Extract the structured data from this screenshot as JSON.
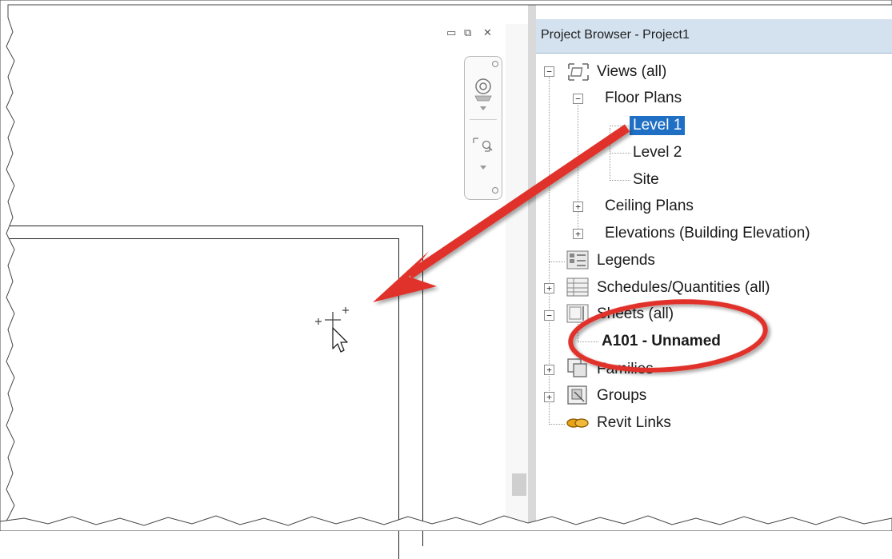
{
  "browser": {
    "title": "Project Browser - Project1"
  },
  "window_controls": {
    "minimize": "▭",
    "restore": "⧉",
    "close": "✕",
    "collapse": "^"
  },
  "tree": {
    "views": "Views (all)",
    "floor_plans": "Floor Plans",
    "level1": "Level 1",
    "level2": "Level 2",
    "site": "Site",
    "ceiling_plans": "Ceiling Plans",
    "elevations": "Elevations (Building Elevation)",
    "legends": "Legends",
    "schedules": "Schedules/Quantities (all)",
    "sheets": "Sheets (all)",
    "sheet_a101": "A101 - Unnamed",
    "families": "Families",
    "groups": "Groups",
    "revit_links": "Revit Links"
  },
  "colors": {
    "selection": "#1f6fc5",
    "annotation_red": "#e0322a",
    "title_bar": "#d4e2f0"
  }
}
